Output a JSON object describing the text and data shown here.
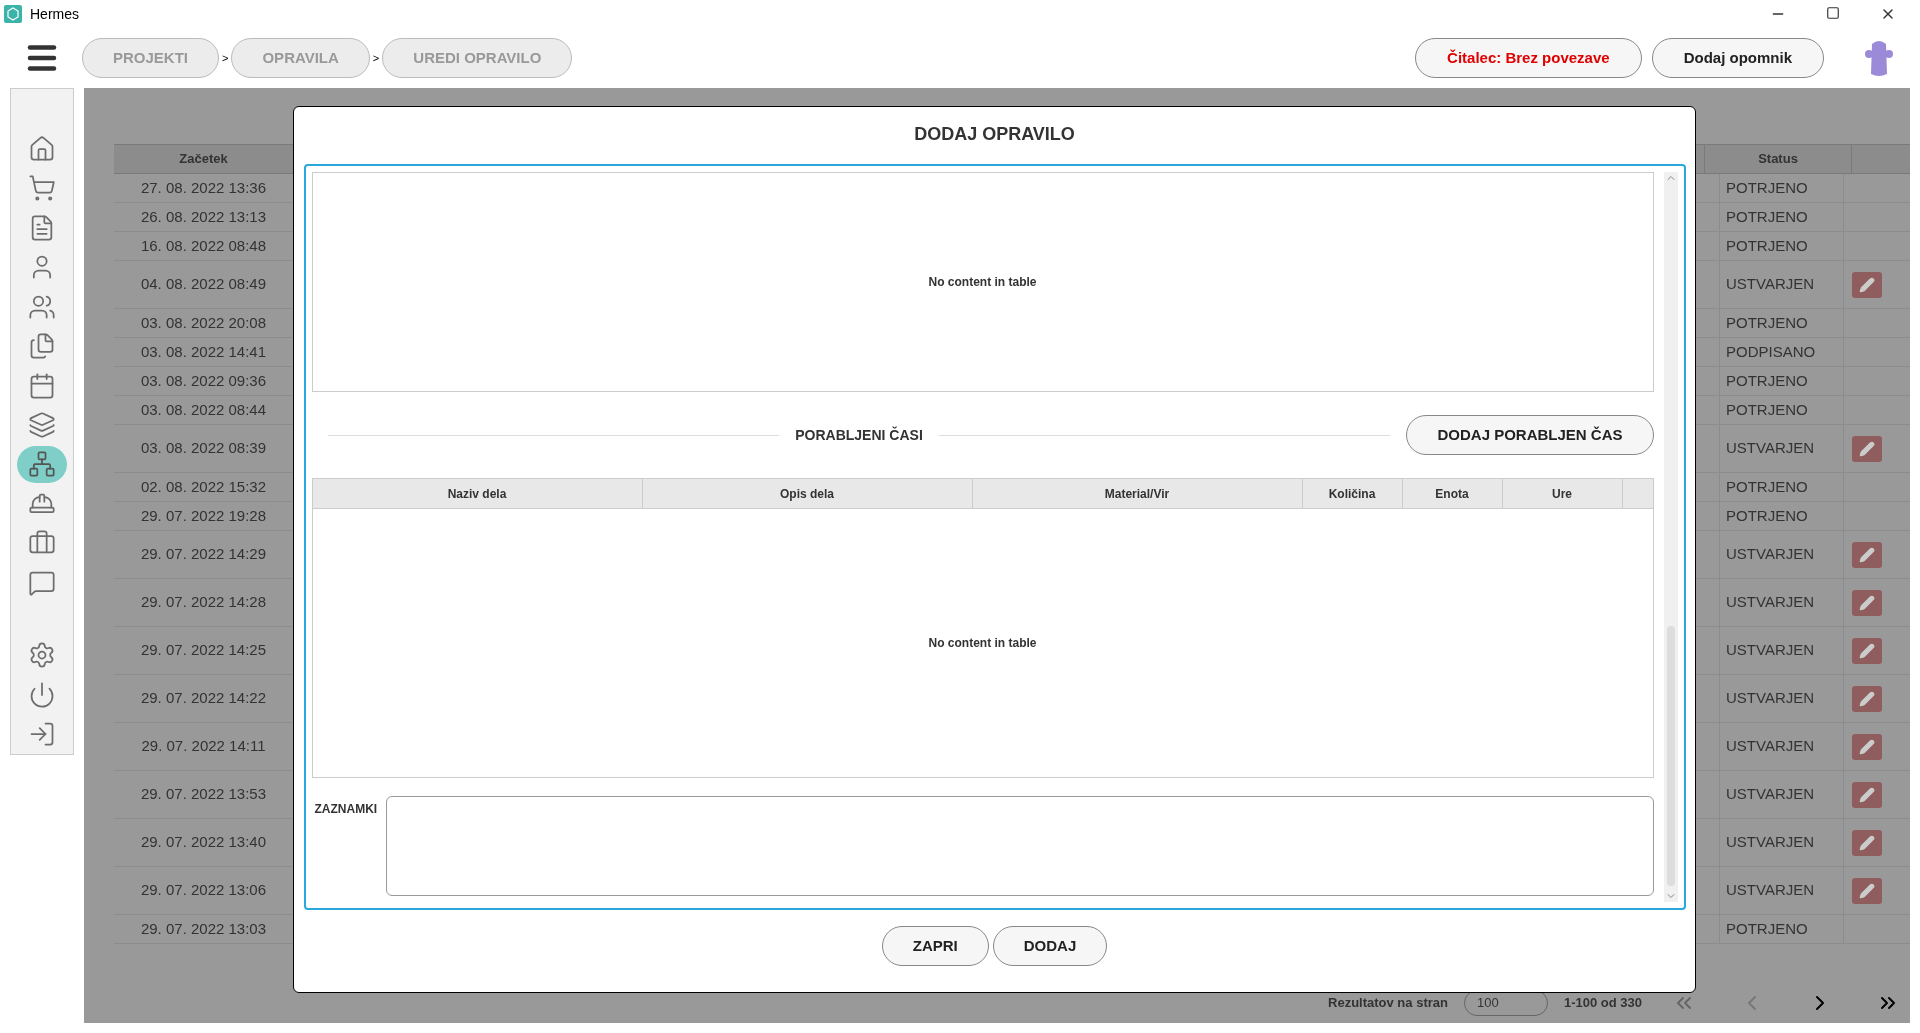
{
  "window": {
    "title": "Hermes"
  },
  "breadcrumbs": [
    {
      "label": "PROJEKTI",
      "separator": ">"
    },
    {
      "label": "OPRAVILA",
      "separator": ">"
    },
    {
      "label": "UREDI OPRAVILO"
    }
  ],
  "header_buttons": [
    {
      "label": "Čitalec: Brez povezave",
      "kind": "warning"
    },
    {
      "label": "Dodaj opomnik",
      "kind": "normal"
    }
  ],
  "sidebar": {
    "items": [
      {
        "selected": false
      },
      {
        "selected": false
      },
      {
        "selected": false
      },
      {
        "selected": false
      },
      {
        "selected": false
      },
      {
        "selected": false
      },
      {
        "selected": false
      },
      {
        "selected": false
      },
      {
        "selected": true
      },
      {
        "selected": false
      },
      {
        "selected": false
      },
      {
        "selected": false
      },
      {
        "selected": false
      },
      {
        "selected": false
      },
      {
        "selected": false
      }
    ]
  },
  "table": {
    "columns": [
      {
        "label": "Začetek"
      },
      {
        "label": "Status"
      }
    ],
    "rows": [
      {
        "start": "27. 08. 2022 13:36",
        "status": "POTRJENO",
        "kind": "plain"
      },
      {
        "start": "26. 08. 2022 13:13",
        "status": "POTRJENO",
        "kind": "plain"
      },
      {
        "start": "16. 08. 2022 08:48",
        "status": "POTRJENO",
        "kind": "plain"
      },
      {
        "start": "04. 08. 2022 08:49",
        "status": "USTVARJEN",
        "kind": "editable"
      },
      {
        "start": "03. 08. 2022 20:08",
        "status": "POTRJENO",
        "kind": "plain"
      },
      {
        "start": "03. 08. 2022 14:41",
        "status": "PODPISANO",
        "kind": "plain"
      },
      {
        "start": "03. 08. 2022 09:36",
        "status": "POTRJENO",
        "kind": "plain"
      },
      {
        "start": "03. 08. 2022 08:44",
        "status": "POTRJENO",
        "kind": "plain"
      },
      {
        "start": "03. 08. 2022 08:39",
        "status": "USTVARJEN",
        "kind": "editable"
      },
      {
        "start": "02. 08. 2022 15:32",
        "status": "POTRJENO",
        "kind": "plain"
      },
      {
        "start": "29. 07. 2022 19:28",
        "status": "POTRJENO",
        "kind": "plain"
      },
      {
        "start": "29. 07. 2022 14:29",
        "status": "USTVARJEN",
        "kind": "editable"
      },
      {
        "start": "29. 07. 2022 14:28",
        "status": "USTVARJEN",
        "kind": "editable"
      },
      {
        "start": "29. 07. 2022 14:25",
        "status": "USTVARJEN",
        "kind": "editable"
      },
      {
        "start": "29. 07. 2022 14:22",
        "status": "USTVARJEN",
        "kind": "editable"
      },
      {
        "start": "29. 07. 2022 14:11",
        "status": "USTVARJEN",
        "kind": "editable"
      },
      {
        "start": "29. 07. 2022 13:53",
        "status": "USTVARJEN",
        "kind": "editable"
      },
      {
        "start": "29. 07. 2022 13:40",
        "status": "USTVARJEN",
        "kind": "editable"
      },
      {
        "start": "29. 07. 2022 13:06",
        "status": "USTVARJEN",
        "kind": "editable"
      },
      {
        "start": "29. 07. 2022 13:03",
        "status": "POTRJENO",
        "kind": "plain"
      }
    ]
  },
  "pagination": {
    "label": "Rezultatov na stran",
    "page_size": "100",
    "range": "1-100 od 330"
  },
  "dialog": {
    "title": "DODAJ OPRAVILO",
    "first_table": {
      "empty_text": "No content in table"
    },
    "section_title": "PORABLJENI ČASI",
    "add_button": "DODAJ PORABLJEN ČAS",
    "time_table": {
      "columns": [
        {
          "label": "Naziv dela"
        },
        {
          "label": "Opis dela"
        },
        {
          "label": "Material/Vir"
        },
        {
          "label": "Količina"
        },
        {
          "label": "Enota"
        },
        {
          "label": "Ure"
        }
      ],
      "empty_text": "No content in table"
    },
    "notes_label": "ZAZNAMKI",
    "buttons": [
      {
        "label": "ZAPRI"
      },
      {
        "label": "DODAJ"
      }
    ]
  }
}
